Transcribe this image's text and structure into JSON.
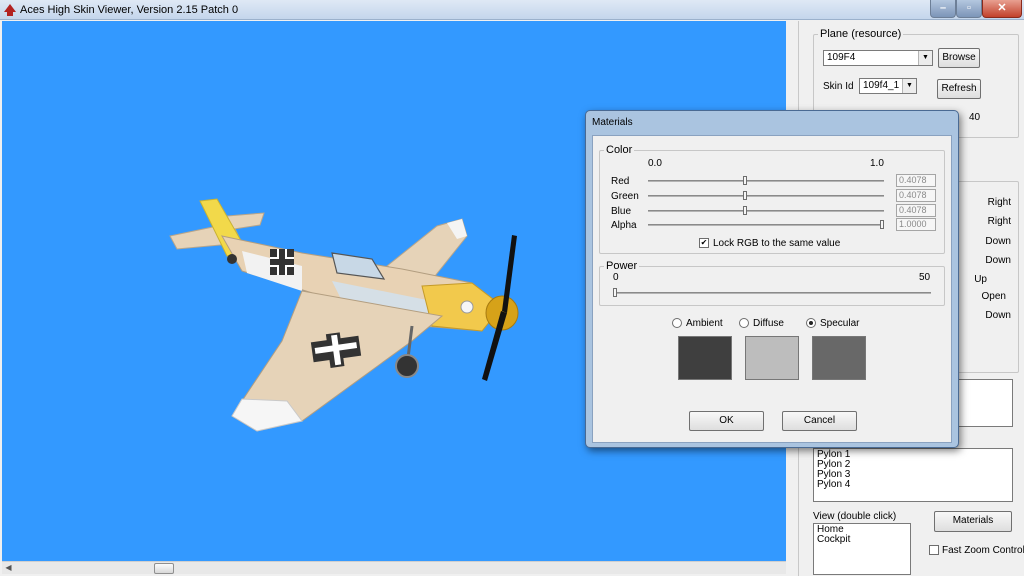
{
  "window": {
    "title": "Aces High Skin Viewer, Version 2.15 Patch 0"
  },
  "plane": {
    "group_label": "Plane (resource)",
    "selected": "109F4",
    "browse_label": "Browse",
    "skin_label": "Skin Id",
    "skin_selected": "109f4_1",
    "refresh_label": "Refresh",
    "value": "40"
  },
  "parts": [
    {
      "state": "Right"
    },
    {
      "state": "Right"
    },
    {
      "state": "Down"
    },
    {
      "state": "Down"
    },
    {
      "state": "Up"
    },
    {
      "state": "Open"
    },
    {
      "state": "Down"
    }
  ],
  "pylons": [
    "Pylon 1",
    "Pylon 2",
    "Pylon 3",
    "Pylon 4"
  ],
  "view": {
    "label": "View (double click)",
    "items": [
      "Home",
      "Cockpit"
    ],
    "materials_label": "Materials",
    "fast_zoom_label": "Fast Zoom Control",
    "fast_zoom_checked": false
  },
  "materials": {
    "title": "Materials",
    "color_group": "Color",
    "scale_min": "0.0",
    "scale_max": "1.0",
    "channels": [
      {
        "label": "Red",
        "value": "0.4078",
        "level": 0.4078
      },
      {
        "label": "Green",
        "value": "0.4078",
        "level": 0.4078
      },
      {
        "label": "Blue",
        "value": "0.4078",
        "level": 0.4078
      },
      {
        "label": "Alpha",
        "value": "1.0000",
        "level": 1.0
      }
    ],
    "lock_label": "Lock RGB to the same value",
    "lock_checked": true,
    "power_group": "Power",
    "power_min": "0",
    "power_max": "50",
    "power_level": 0,
    "modes": [
      {
        "label": "Ambient",
        "selected": false,
        "swatch": "#3f3f3f"
      },
      {
        "label": "Diffuse",
        "selected": false,
        "swatch": "#bdbdbd"
      },
      {
        "label": "Specular",
        "selected": true,
        "swatch": "#686868"
      }
    ],
    "ok_label": "OK",
    "cancel_label": "Cancel"
  },
  "colors": {
    "viewport_bg": "#3399ff"
  }
}
